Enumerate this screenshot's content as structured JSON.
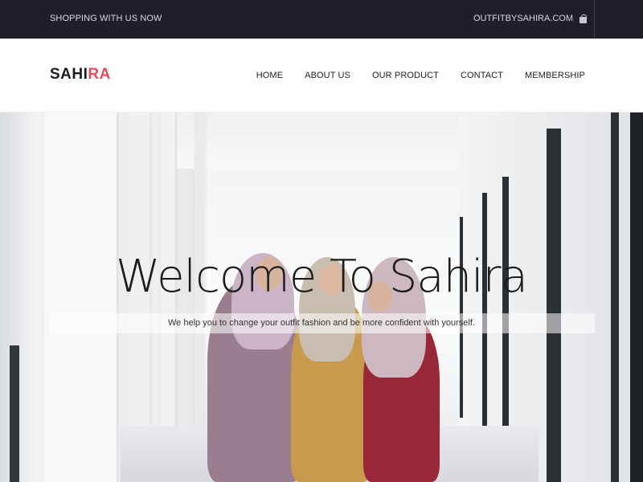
{
  "topbar": {
    "tagline": "SHOPPING WITH US NOW",
    "site_link": "OUTFITBYSAHIRA.COM",
    "site_icon": "shopping-bag-icon"
  },
  "navbar": {
    "logo_primary": "SAHI",
    "logo_accent": "RA",
    "accent_color": "#e84a5f",
    "menu": [
      {
        "label": "HOME"
      },
      {
        "label": "ABOUT US"
      },
      {
        "label": "OUR PRODUCT"
      },
      {
        "label": "CONTACT"
      },
      {
        "label": "MEMBERSHIP"
      }
    ]
  },
  "hero": {
    "title": "Welcome To Sahira",
    "subtitle": "We help you to change your outfit fashion and be more confident with yourself."
  },
  "colors": {
    "topbar_bg": "#1f1f2b",
    "text_dark": "#1c1c1c"
  }
}
